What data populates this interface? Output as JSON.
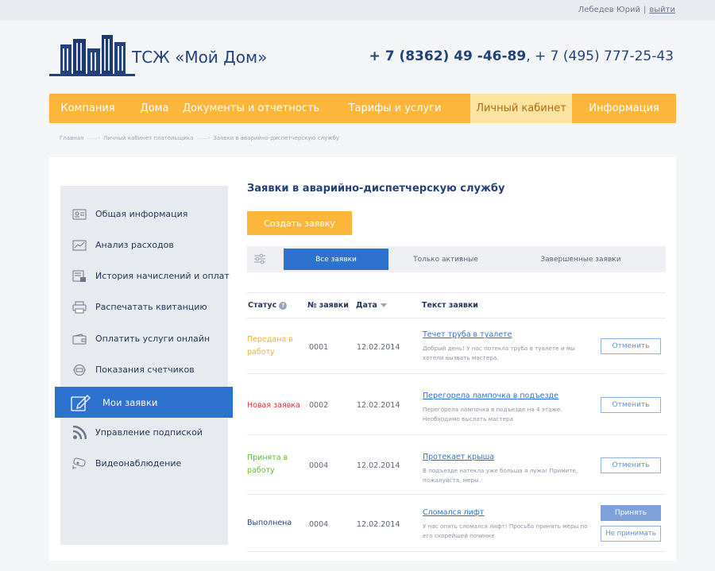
{
  "topbar": {
    "user_name": "Лебедев Юрий",
    "separator": "|",
    "logout": "выйти"
  },
  "header": {
    "brand": "ТСЖ «Мой Дом»",
    "phone_main": "+ 7 (8362) 49 -46-89",
    "phone_sep": ", ",
    "phone_alt": "+ 7 (495) 777-25-43"
  },
  "nav": {
    "items": [
      {
        "label": "Компания"
      },
      {
        "label": "Дома"
      },
      {
        "label": "Документы и отчетность"
      },
      {
        "label": "Тарифы и услуги"
      },
      {
        "label": "Личный кабинет"
      },
      {
        "label": "Информация"
      }
    ],
    "active_index": 4
  },
  "breadcrumb": {
    "items": [
      "Главная",
      "Личный кабинет плательщика",
      "Заявки в аварийно-диспетчерскую службу"
    ],
    "arrow": "——›"
  },
  "sidebar": {
    "items": [
      {
        "label": "Общая информация",
        "icon": "id-card-icon"
      },
      {
        "label": "Анализ расходов",
        "icon": "chart-icon"
      },
      {
        "label": "История начислений и оплат",
        "icon": "history-icon"
      },
      {
        "label": "Распечатать квитанцию",
        "icon": "printer-icon"
      },
      {
        "label": "Оплатить услуги онлайн",
        "icon": "wallet-icon"
      },
      {
        "label": "Показания счетчиков",
        "icon": "meter-icon"
      },
      {
        "label": "Мои заявки",
        "icon": "edit-icon"
      },
      {
        "label": "Управление подпиской",
        "icon": "rss-icon"
      },
      {
        "label": "Видеонаблюдение",
        "icon": "camera-icon"
      }
    ],
    "active_index": 6
  },
  "main": {
    "title": "Заявки в аварийно-диспетчерскую службу",
    "create_button": "Создать заявку",
    "tabs": [
      {
        "label": "Все заявки"
      },
      {
        "label": "Только активные"
      },
      {
        "label": "Завершенные заявки"
      }
    ],
    "active_tab": 0,
    "columns": {
      "status": "Статус",
      "status_help": "?",
      "number": "№ заявки",
      "date": "Дата",
      "text": "Текст заявки"
    },
    "rows": [
      {
        "status": "Передана в работу",
        "status_color": "#f5b324",
        "number": "0001",
        "date": "12.02.2014",
        "title": "Течет труба в туалете",
        "text": "Добрый день! У нас потекла труба в туалете и мы хотели вызвать мастера.",
        "action": "Отменить"
      },
      {
        "status": "Новая заявка",
        "status_color": "#e2332d",
        "number": "0002",
        "date": "12.02.2014",
        "title": "Перегорела лампочка в подъезде",
        "text": "Перегорела лампочка в подъезде на 4 этаже. Необходимо выслать мастера",
        "action": "Отменить"
      },
      {
        "status": "Принята в работу",
        "status_color": "#5cbf2a",
        "number": "0004",
        "date": "12.02.2014",
        "title": "Протекает крыша",
        "text": "В подъезде натекла уже больша я лужа! Примите, пожалуйста, меры.",
        "action": "Отменить"
      },
      {
        "status": "Выполнена",
        "status_color": "#24427a",
        "number": "0004",
        "date": "12.02.2014",
        "title": "Сломался лифт",
        "text": "У нас опять сломался лифт! Просьба принять меры по его скорейшей починке",
        "accept": "Принять",
        "reject": "Не принимать"
      }
    ]
  },
  "colors": {
    "accent_orange": "#fbb63b",
    "accent_blue": "#2e72cf",
    "navy": "#24427a"
  }
}
